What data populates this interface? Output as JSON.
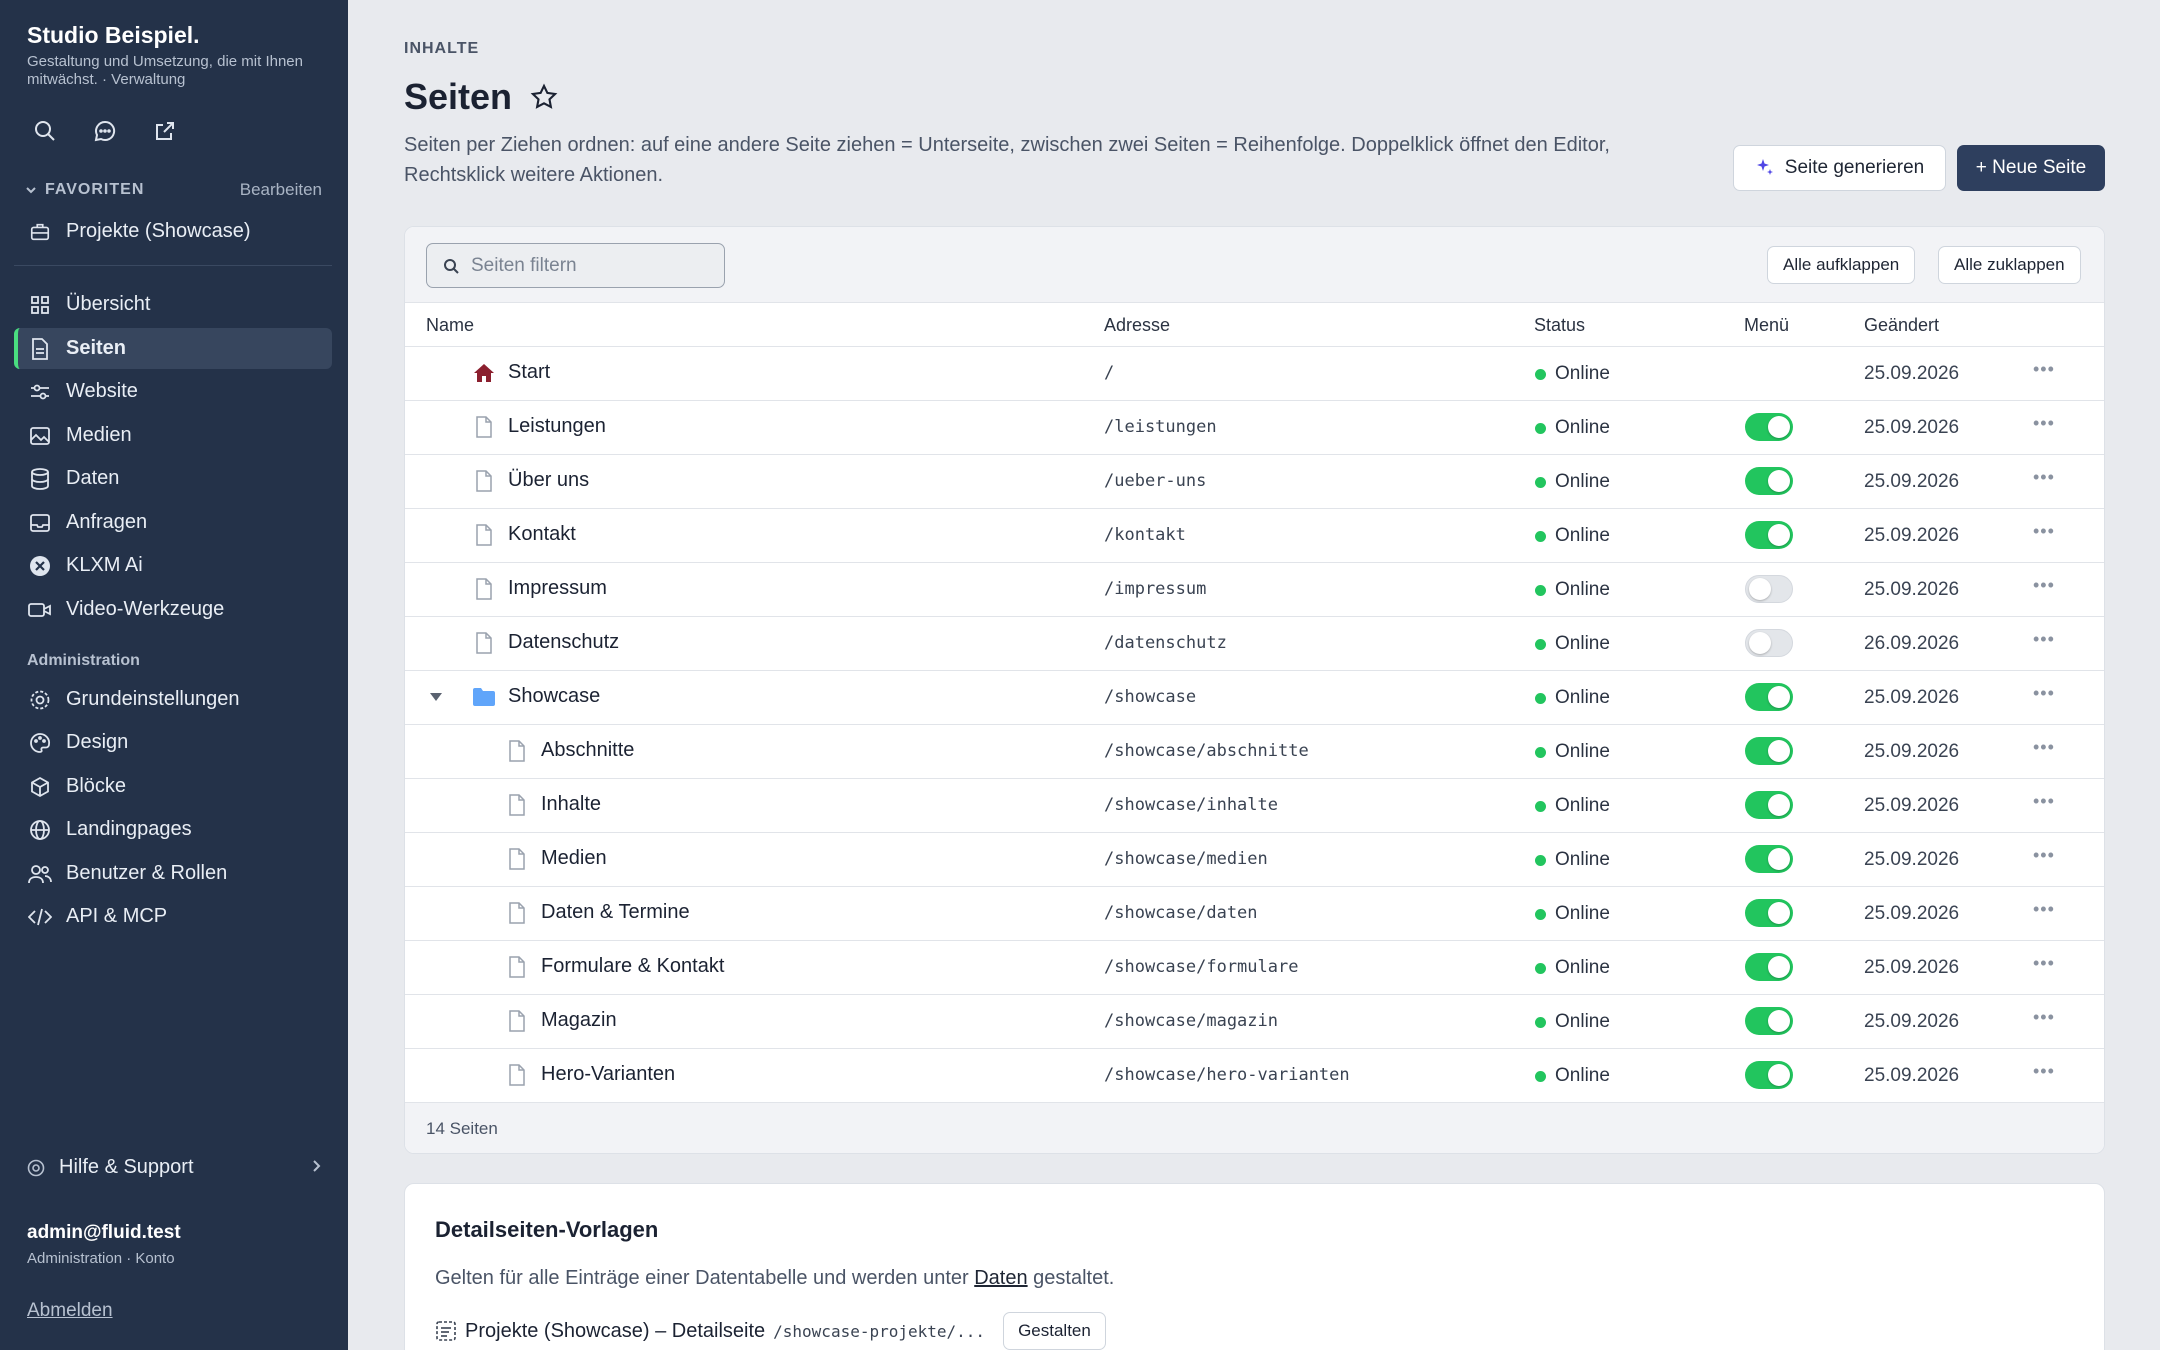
{
  "sidebar": {
    "brand_title": "Studio Beispiel.",
    "brand_sub": "Gestaltung und Umsetzung, die mit Ihnen mitwächst. · Verwaltung",
    "favorites_label": "FAVORITEN",
    "favorites_edit": "Bearbeiten",
    "favorite_item": "Projekte (Showcase)",
    "items": [
      {
        "label": "Übersicht",
        "icon": "grid-icon"
      },
      {
        "label": "Seiten",
        "icon": "document-icon",
        "active": true
      },
      {
        "label": "Website",
        "icon": "sliders-icon"
      },
      {
        "label": "Medien",
        "icon": "image-icon"
      },
      {
        "label": "Daten",
        "icon": "database-icon"
      },
      {
        "label": "Anfragen",
        "icon": "inbox-icon"
      },
      {
        "label": "KLXM Ai",
        "icon": "ai-icon"
      },
      {
        "label": "Video-Werkzeuge",
        "icon": "video-icon"
      }
    ],
    "admin_label": "Administration",
    "admin_items": [
      {
        "label": "Grundeinstellungen",
        "icon": "gear-icon"
      },
      {
        "label": "Design",
        "icon": "palette-icon"
      },
      {
        "label": "Blöcke",
        "icon": "cube-icon"
      },
      {
        "label": "Landingpages",
        "icon": "globe-icon"
      },
      {
        "label": "Benutzer & Rollen",
        "icon": "users-icon"
      },
      {
        "label": "API & MCP",
        "icon": "code-icon"
      }
    ],
    "help": "Hilfe & Support",
    "user_email": "admin@fluid.test",
    "user_role": "Administration · Konto",
    "logout": "Abmelden"
  },
  "header": {
    "kicker": "INHALTE",
    "title": "Seiten",
    "description": "Seiten per Ziehen ordnen: auf eine andere Seite ziehen = Unterseite, zwischen zwei Seiten = Reihenfolge. Doppelklick öffnet den Editor, Rechtsklick weitere Aktionen.",
    "generate_label": "Seite generieren",
    "new_label": "+ Neue Seite"
  },
  "table": {
    "search_placeholder": "Seiten filtern",
    "expand_all": "Alle aufklappen",
    "collapse_all": "Alle zuklappen",
    "columns": {
      "name": "Name",
      "address": "Adresse",
      "status": "Status",
      "menu": "Menü",
      "changed": "Geändert"
    },
    "rows": [
      {
        "name": "Start",
        "address": "/",
        "status": "Online",
        "menu": null,
        "changed": "25.09.2026",
        "type": "home",
        "level": 0
      },
      {
        "name": "Leistungen",
        "address": "/leistungen",
        "status": "Online",
        "menu": true,
        "changed": "25.09.2026",
        "type": "page",
        "level": 0
      },
      {
        "name": "Über uns",
        "address": "/ueber-uns",
        "status": "Online",
        "menu": true,
        "changed": "25.09.2026",
        "type": "page",
        "level": 0
      },
      {
        "name": "Kontakt",
        "address": "/kontakt",
        "status": "Online",
        "menu": true,
        "changed": "25.09.2026",
        "type": "page",
        "level": 0
      },
      {
        "name": "Impressum",
        "address": "/impressum",
        "status": "Online",
        "menu": false,
        "changed": "25.09.2026",
        "type": "page",
        "level": 0
      },
      {
        "name": "Datenschutz",
        "address": "/datenschutz",
        "status": "Online",
        "menu": false,
        "changed": "26.09.2026",
        "type": "page",
        "level": 0
      },
      {
        "name": "Showcase",
        "address": "/showcase",
        "status": "Online",
        "menu": true,
        "changed": "25.09.2026",
        "type": "folder",
        "level": 0
      },
      {
        "name": "Abschnitte",
        "address": "/showcase/abschnitte",
        "status": "Online",
        "menu": true,
        "changed": "25.09.2026",
        "type": "page",
        "level": 1
      },
      {
        "name": "Inhalte",
        "address": "/showcase/inhalte",
        "status": "Online",
        "menu": true,
        "changed": "25.09.2026",
        "type": "page",
        "level": 1
      },
      {
        "name": "Medien",
        "address": "/showcase/medien",
        "status": "Online",
        "menu": true,
        "changed": "25.09.2026",
        "type": "page",
        "level": 1
      },
      {
        "name": "Daten & Termine",
        "address": "/showcase/daten",
        "status": "Online",
        "menu": true,
        "changed": "25.09.2026",
        "type": "page",
        "level": 1
      },
      {
        "name": "Formulare & Kontakt",
        "address": "/showcase/formulare",
        "status": "Online",
        "menu": true,
        "changed": "25.09.2026",
        "type": "page",
        "level": 1
      },
      {
        "name": "Magazin",
        "address": "/showcase/magazin",
        "status": "Online",
        "menu": true,
        "changed": "25.09.2026",
        "type": "page",
        "level": 1
      },
      {
        "name": "Hero-Varianten",
        "address": "/showcase/hero-varianten",
        "status": "Online",
        "menu": true,
        "changed": "25.09.2026",
        "type": "page",
        "level": 1
      }
    ],
    "footer": "14 Seiten"
  },
  "detail": {
    "title": "Detailseiten-Vorlagen",
    "desc_before": "Gelten für alle Einträge einer Datentabelle und werden unter ",
    "desc_link": "Daten",
    "desc_after": " gestaltet.",
    "template_name": "Projekte (Showcase) – Detailseite",
    "template_path": "/showcase-projekte/...",
    "template_button": "Gestalten"
  },
  "colors": {
    "sidebar_bg": "#243249",
    "accent": "#22c55e",
    "primary_button": "#2e3f5e",
    "home_icon": "#8b1f2e",
    "folder_icon": "#60a5fa"
  }
}
